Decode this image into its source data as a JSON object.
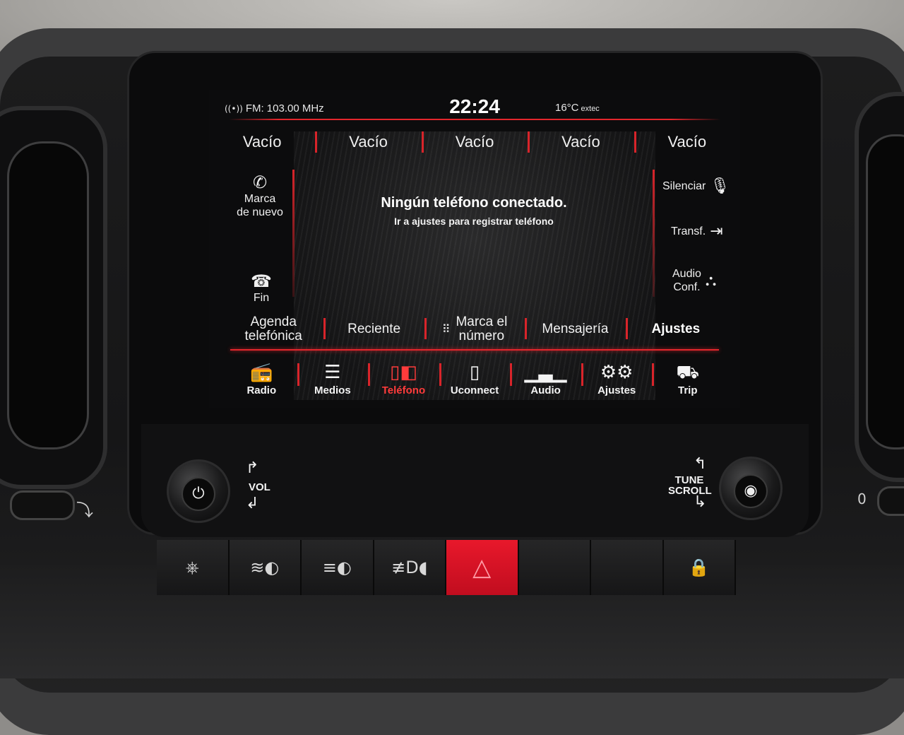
{
  "status": {
    "radio": "FM: 103.00 MHz",
    "time": "22:24",
    "temperature": "16°C",
    "temperature_suffix": "extec"
  },
  "favorites": [
    "Vacío",
    "Vacío",
    "Vacío",
    "Vacío",
    "Vacío"
  ],
  "left_actions": {
    "redial": {
      "label_line1": "Marca",
      "label_line2": "de nuevo",
      "icon": "phone-icon"
    },
    "end": {
      "label": "Fin",
      "icon": "hangup-icon"
    }
  },
  "right_actions": {
    "mute": {
      "label": "Silenciar",
      "icon": "mute-mic-icon"
    },
    "transfer": {
      "label": "Transf.",
      "icon": "transfer-icon"
    },
    "conference": {
      "label_line1": "Audio",
      "label_line2": "Conf.",
      "icon": "conference-icon"
    }
  },
  "message": {
    "title": "Ningún teléfono conectado.",
    "subtitle": "Ir a ajustes para registrar teléfono"
  },
  "phone_menu": [
    {
      "line1": "Agenda",
      "line2": "telefónica"
    },
    {
      "line1": "Reciente",
      "line2": ""
    },
    {
      "line1": "Marca el",
      "line2": "número",
      "icon": "keypad-icon"
    },
    {
      "line1": "Mensajería",
      "line2": ""
    },
    {
      "line1": "Ajustes",
      "line2": "",
      "active": true
    }
  ],
  "nav": [
    {
      "label": "Radio",
      "icon": "radio-icon"
    },
    {
      "label": "Medios",
      "icon": "media-icon"
    },
    {
      "label": "Teléfono",
      "icon": "phone-screen-icon",
      "active": true
    },
    {
      "label": "Uconnect",
      "icon": "uconnect-icon"
    },
    {
      "label": "Audio",
      "icon": "audio-icon"
    },
    {
      "label": "Ajustes",
      "icon": "settings-icon"
    },
    {
      "label": "Trip",
      "icon": "trip-icon"
    }
  ],
  "controls": {
    "volume_label": "VOL",
    "tune_label_line1": "TUNE",
    "tune_label_line2": "SCROLL"
  },
  "side_labels": {
    "right_vent_value": "0"
  },
  "colors": {
    "accent": "#e3262c",
    "active_nav": "#ff3b3b",
    "hazard": "#e8182b"
  }
}
